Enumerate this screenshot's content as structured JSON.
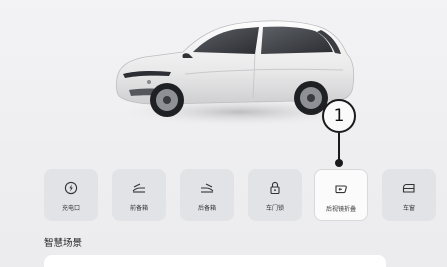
{
  "callout": {
    "number": "1"
  },
  "controls": [
    {
      "label": "充电口",
      "icon": "charge-port-icon"
    },
    {
      "label": "前备箱",
      "icon": "front-trunk-icon"
    },
    {
      "label": "后备箱",
      "icon": "rear-trunk-icon"
    },
    {
      "label": "车门锁",
      "icon": "door-lock-icon"
    },
    {
      "label": "后视镜折叠",
      "icon": "mirror-fold-icon",
      "selected": true
    },
    {
      "label": "车窗",
      "icon": "window-icon"
    }
  ],
  "smart_scene": {
    "title": "智慧场景"
  },
  "colors": {
    "background": "#efeff1",
    "tile": "#e2e3e7",
    "tile_active": "#fbfbfc",
    "text": "#333333"
  }
}
